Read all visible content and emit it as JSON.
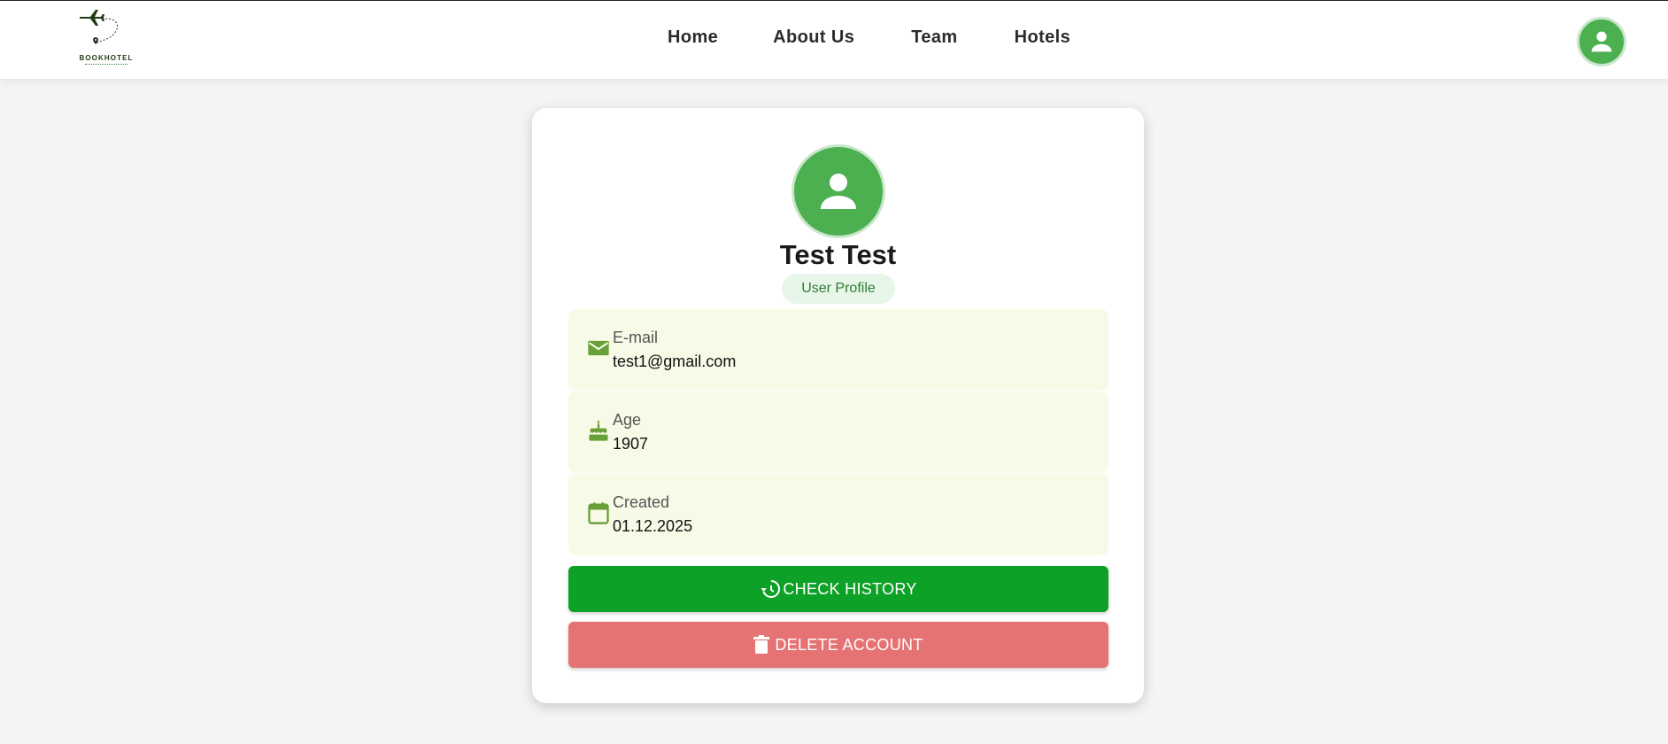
{
  "brand": {
    "logo_text": "BOOKHOTEL"
  },
  "nav": {
    "items": [
      {
        "label": "Home"
      },
      {
        "label": "About Us"
      },
      {
        "label": "Team"
      },
      {
        "label": "Hotels"
      }
    ]
  },
  "header": {
    "avatar_icon": "account-icon"
  },
  "profile": {
    "name": "Test Test",
    "role_chip": "User Profile",
    "fields": [
      {
        "icon": "email-icon",
        "label": "E-mail",
        "value": "test1@gmail.com"
      },
      {
        "icon": "cake-icon",
        "label": "Age",
        "value": "1907"
      },
      {
        "icon": "calendar-icon",
        "label": "Created",
        "value": "01.12.2025"
      }
    ],
    "actions": {
      "history_label": "CHECK HISTORY",
      "delete_label": "DELETE ACCOUNT"
    }
  },
  "colors": {
    "accent_green": "#4caf50",
    "primary_button": "#0ea128",
    "danger_button": "#e57373",
    "info_background": "#f7fae6",
    "chip_background": "#e8f5e9",
    "icon_green": "#689f38"
  }
}
